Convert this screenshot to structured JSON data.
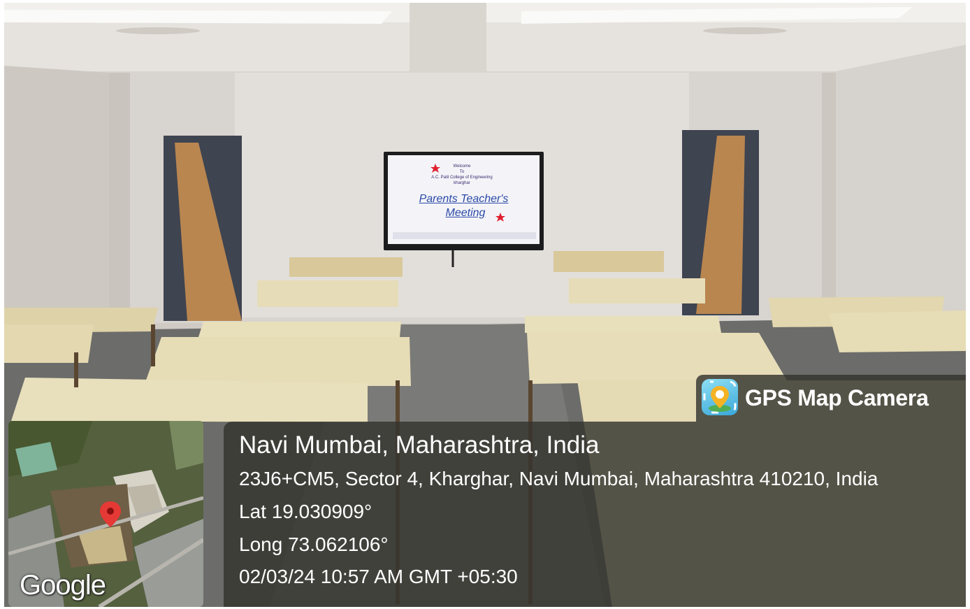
{
  "tv": {
    "welcome": "Welcome",
    "to": "To",
    "college": "A.C. Patil College of Engineering",
    "location": "kharghar",
    "line1": "Parents Teacher's",
    "line2": "Meeting"
  },
  "badge": {
    "title": "GPS Map Camera",
    "icon": "map-pin-camera-icon"
  },
  "location": {
    "place": "Navi Mumbai, Maharashtra, India",
    "address": "23J6+CM5, Sector 4, Kharghar, Navi Mumbai, Maharashtra 410210, India",
    "lat": "Lat 19.030909°",
    "long": "Long 73.062106°",
    "datetime": "02/03/24 10:57 AM GMT +05:30"
  },
  "map": {
    "logo": "Google",
    "pin_color": "#e53935"
  }
}
